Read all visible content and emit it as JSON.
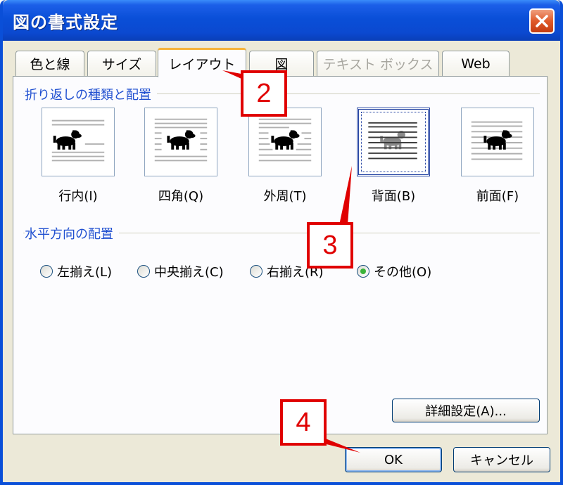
{
  "window": {
    "title": "図の書式設定"
  },
  "tabs": [
    {
      "label": "色と線",
      "state": "normal"
    },
    {
      "label": "サイズ",
      "state": "normal"
    },
    {
      "label": "レイアウト",
      "state": "active"
    },
    {
      "label": "図",
      "state": "normal"
    },
    {
      "label": "テキスト ボックス",
      "state": "disabled"
    },
    {
      "label": "Web",
      "state": "normal"
    }
  ],
  "wrap_section": {
    "title": "折り返しの種類と配置",
    "options": [
      {
        "label": "行内(I)",
        "icon": "inline-dog-icon"
      },
      {
        "label": "四角(Q)",
        "icon": "square-wrap-dog-icon"
      },
      {
        "label": "外周(T)",
        "icon": "tight-wrap-dog-icon"
      },
      {
        "label": "背面(B)",
        "icon": "behind-text-dog-icon",
        "selected": true
      },
      {
        "label": "前面(F)",
        "icon": "in-front-dog-icon"
      }
    ]
  },
  "align_section": {
    "title": "水平方向の配置",
    "options": [
      {
        "label": "左揃え(L)",
        "checked": false
      },
      {
        "label": "中央揃え(C)",
        "checked": false
      },
      {
        "label": "右揃え(R)",
        "checked": false
      },
      {
        "label": "その他(O)",
        "checked": true
      }
    ]
  },
  "buttons": {
    "advanced": "詳細設定(A)...",
    "ok": "OK",
    "cancel": "キャンセル"
  },
  "callouts": [
    "2",
    "3",
    "4"
  ],
  "colors": {
    "titlebar": "#0a4fd8",
    "dialog_bg": "#ece9d8",
    "group_label": "#1f4fd0",
    "callout_red": "#e00000",
    "active_tab_accent": "#f6b33a"
  }
}
